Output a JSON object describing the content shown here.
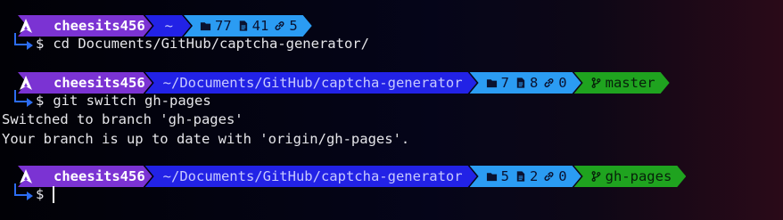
{
  "prompts": [
    {
      "user": "cheesits456",
      "path": "~",
      "stats": {
        "dirs": "77",
        "files": "41",
        "links": "5"
      },
      "branch": null,
      "command": "cd Documents/GitHub/captcha-generator/"
    },
    {
      "user": "cheesits456",
      "path": "~/Documents/GitHub/captcha-generator",
      "stats": {
        "dirs": "7",
        "files": "8",
        "links": "0"
      },
      "branch": "master",
      "command": "git switch gh-pages",
      "output": [
        "Switched to branch 'gh-pages'",
        "Your branch is up to date with 'origin/gh-pages'."
      ]
    },
    {
      "user": "cheesits456",
      "path": "~/Documents/GitHub/captcha-generator",
      "stats": {
        "dirs": "5",
        "files": "2",
        "links": "0"
      },
      "branch": "gh-pages",
      "command": ""
    }
  ],
  "prompt_symbol": "$",
  "colors": {
    "user_segment": "#7b33d3",
    "path_segment": "#2222e6",
    "stats_segment": "#2b9cf3",
    "git_segment": "#1fa31f",
    "connector": "#2c6cf0"
  },
  "icons": {
    "logo": "arch-linux-icon",
    "dirs": "folder-icon",
    "files": "file-icon",
    "links": "link-icon",
    "branch": "git-branch-icon"
  }
}
